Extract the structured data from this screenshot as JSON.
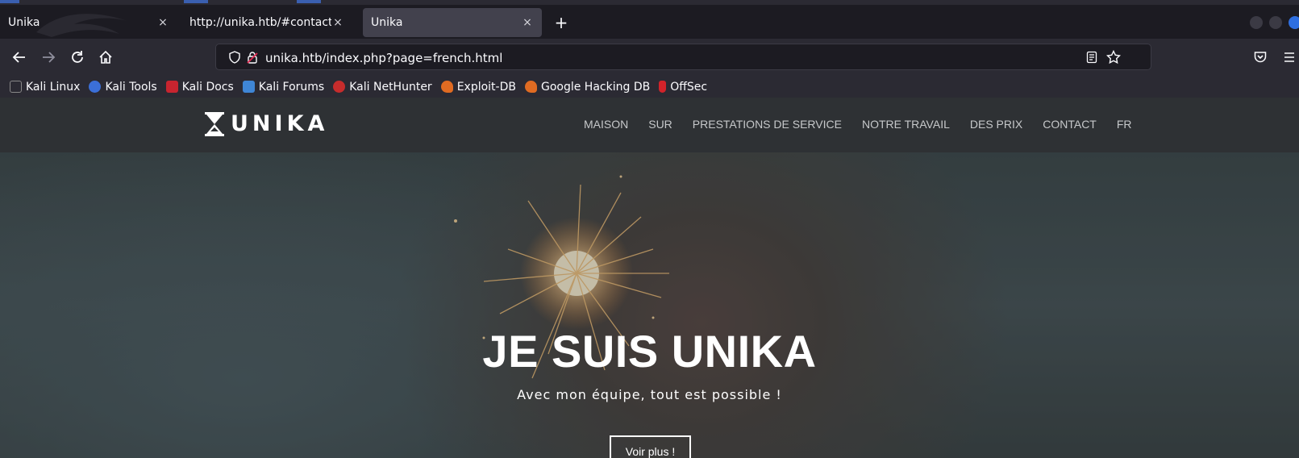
{
  "browser": {
    "tabs": [
      {
        "label": "Unika",
        "active": false
      },
      {
        "label": "http://unika.htb/#contact-sec",
        "active": false
      },
      {
        "label": "Unika",
        "active": true
      }
    ],
    "close_glyph": "×",
    "new_tab_glyph": "+",
    "url": "unika.htb/index.php?page=french.html",
    "bookmarks": [
      {
        "label": "Kali Linux",
        "icon": "kali-dragon-icon"
      },
      {
        "label": "Kali Tools",
        "icon": "kali-tools-icon"
      },
      {
        "label": "Kali Docs",
        "icon": "kali-docs-icon"
      },
      {
        "label": "Kali Forums",
        "icon": "kali-forums-icon"
      },
      {
        "label": "Kali NetHunter",
        "icon": "kali-nethunter-icon"
      },
      {
        "label": "Exploit-DB",
        "icon": "exploit-db-icon"
      },
      {
        "label": "Google Hacking DB",
        "icon": "ghdb-icon"
      },
      {
        "label": "OffSec",
        "icon": "offsec-icon"
      }
    ]
  },
  "site": {
    "logo_text": "UNIKA",
    "menu": [
      "MAISON",
      "SUR",
      "PRESTATIONS DE SERVICE",
      "NOTRE TRAVAIL",
      "DES PRIX",
      "CONTACT",
      "FR"
    ],
    "hero": {
      "title": "JE SUIS UNIKA",
      "subtitle": "Avec mon équipe, tout est possible !",
      "button": "Voir plus !"
    }
  },
  "colors": {
    "accent": "#2f6fe0",
    "site_nav_bg": "#2e3134",
    "browser_bg": "#1c1b22"
  }
}
